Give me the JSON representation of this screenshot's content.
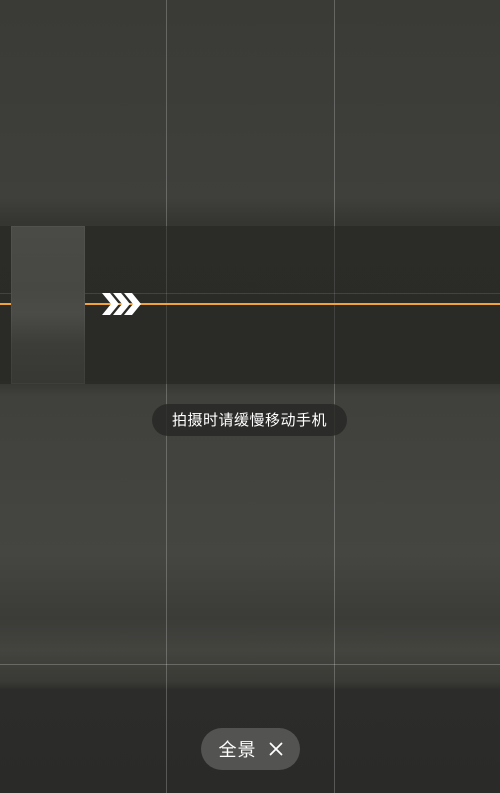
{
  "camera": {
    "mode": "panorama",
    "hint_text": "拍摄时请缓慢移动手机",
    "mode_label": "全景",
    "guide_line_color": "#f2a23a",
    "direction": "right"
  },
  "icons": {
    "direction_arrows": "triple-chevron-right-icon",
    "close": "close-icon"
  }
}
